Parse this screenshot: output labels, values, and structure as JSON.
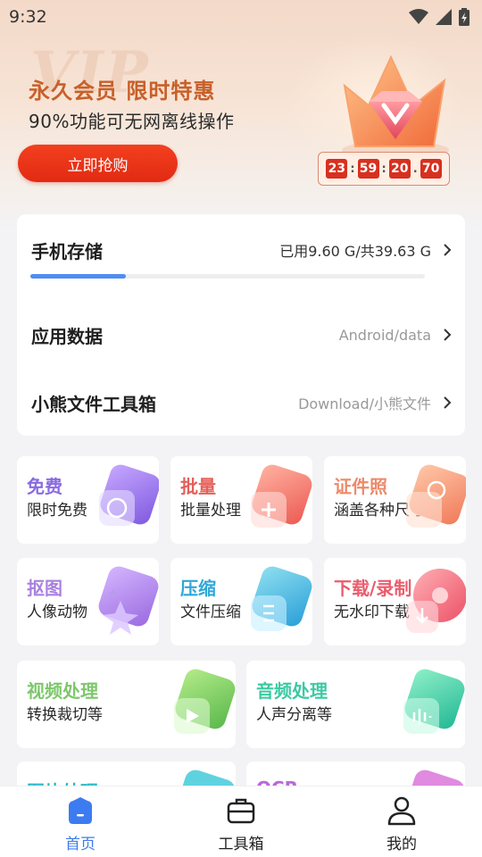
{
  "status_bar": {
    "time": "9:32"
  },
  "banner": {
    "watermark": "VIP",
    "title": "永久会员 限时特惠",
    "subtitle": "90%功能可无网离线操作",
    "buy_button": "立即抢购",
    "countdown": [
      "23",
      "59",
      "20",
      "70"
    ]
  },
  "storage": {
    "phone_label": "手机存储",
    "phone_value": "已用9.60 G/共39.63 G",
    "used_fraction": 0.242,
    "app_data_label": "应用数据",
    "app_data_value": "Android/data",
    "toolbox_label": "小熊文件工具箱",
    "toolbox_value": "Download/小熊文件"
  },
  "tiles": [
    {
      "title": "免费",
      "subtitle": "限时免费",
      "color": "#8a6be0",
      "icon": "gift-icon"
    },
    {
      "title": "批量",
      "subtitle": "批量处理",
      "color": "#e4605a",
      "icon": "batch-icon"
    },
    {
      "title": "证件照",
      "subtitle": "涵盖各种尺寸",
      "color": "#ec8a6a",
      "icon": "id-photo-icon"
    },
    {
      "title": "抠图",
      "subtitle": "人像动物",
      "color": "#a981e0",
      "icon": "cutout-icon"
    },
    {
      "title": "压缩",
      "subtitle": "文件压缩",
      "color": "#2fa7d8",
      "icon": "compress-icon"
    },
    {
      "title": "下载/录制",
      "subtitle": "无水印下载",
      "color": "#ea5d6d",
      "icon": "download-icon"
    },
    {
      "title": "视频处理",
      "subtitle": "转换裁切等",
      "color": "#7dc76b",
      "icon": "video-icon"
    },
    {
      "title": "音频处理",
      "subtitle": "人声分离等",
      "color": "#3cc9a3",
      "icon": "audio-icon"
    },
    {
      "title": "图片处理",
      "subtitle": "",
      "color": "#2fb9c9",
      "icon": "image-icon"
    },
    {
      "title": "OCR",
      "subtitle": "",
      "color": "#b86ad8",
      "icon": "ocr-icon"
    }
  ],
  "bottom_nav": [
    {
      "label": "首页",
      "icon": "home-icon",
      "active": true
    },
    {
      "label": "工具箱",
      "icon": "toolbox-icon",
      "active": false
    },
    {
      "label": "我的",
      "icon": "profile-icon",
      "active": false
    }
  ],
  "colors": {
    "accent": "#3d7bf0",
    "buy_button": "#e22a12",
    "promo_title": "#c8602a"
  }
}
